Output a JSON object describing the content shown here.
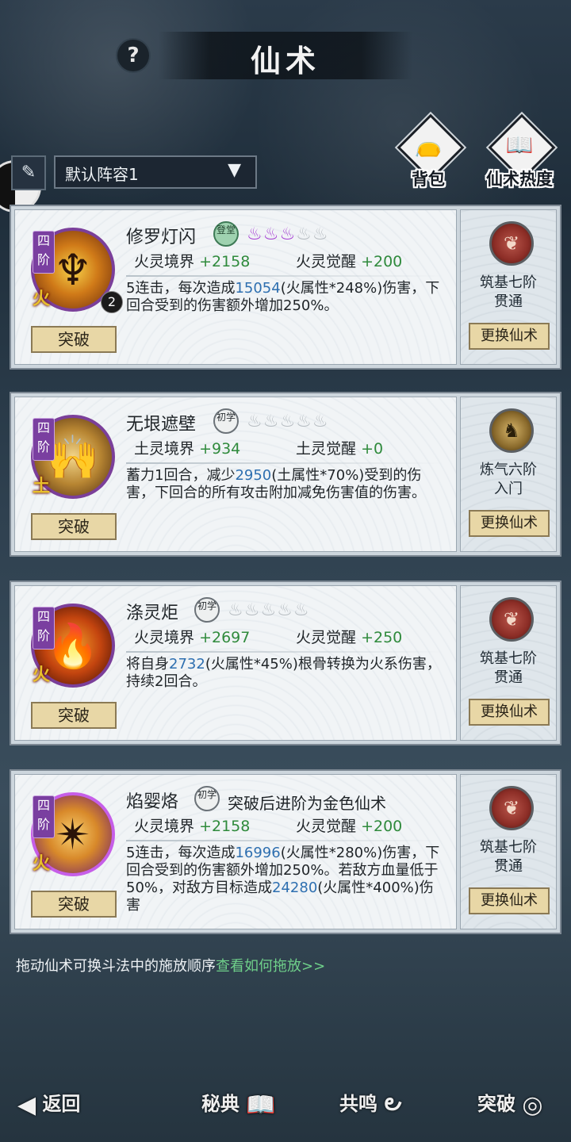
{
  "header": {
    "title": "仙术",
    "help_icon": "?"
  },
  "top_buttons": [
    {
      "label": "背包",
      "icon": "bag-icon",
      "glyph": "👝"
    },
    {
      "label": "仙术热度",
      "icon": "book-flame-icon",
      "glyph": "📖"
    }
  ],
  "lineup": {
    "selected": "默认阵容1",
    "pen_glyph": "✎",
    "chevron": "▼"
  },
  "skills": [
    {
      "tier": "四阶",
      "element": "火",
      "name": "修罗灯闪",
      "rank": "登堂",
      "count": "2",
      "flames_on": "♨♨♨",
      "flames_off": "♨♨",
      "note": "",
      "stat1_label": "火灵境界",
      "stat1_value": "+2158",
      "stat2_label": "火灵觉醒",
      "stat2_value": "+200",
      "desc_pre": "5连击，每次造成",
      "desc_hl": "15054",
      "desc_post": "(火属性*248%)伤害，下回合受到的伤害额外增加250%。",
      "desc_hl2": "",
      "desc_post2": "",
      "break_label": "突破",
      "realm": "筑基七阶",
      "realm_sub": "贯通",
      "swap_label": "更换仙术"
    },
    {
      "tier": "四阶",
      "element": "土",
      "name": "无垠遮壁",
      "rank": "初学",
      "count": "",
      "flames_on": "",
      "flames_off": "♨♨♨♨♨",
      "note": "",
      "stat1_label": "土灵境界",
      "stat1_value": "+934",
      "stat2_label": "土灵觉醒",
      "stat2_value": "+0",
      "desc_pre": "蓄力1回合，减少",
      "desc_hl": "2950",
      "desc_post": "(土属性*70%)受到的伤害，下回合的所有攻击附加减免伤害值的伤害。",
      "desc_hl2": "",
      "desc_post2": "",
      "break_label": "突破",
      "realm": "炼气六阶",
      "realm_sub": "入门",
      "swap_label": "更换仙术"
    },
    {
      "tier": "四阶",
      "element": "火",
      "name": "涤灵炬",
      "rank": "初学",
      "count": "",
      "flames_on": "",
      "flames_off": "♨♨♨♨♨",
      "note": "",
      "stat1_label": "火灵境界",
      "stat1_value": "+2697",
      "stat2_label": "火灵觉醒",
      "stat2_value": "+250",
      "desc_pre": "将自身",
      "desc_hl": "2732",
      "desc_post": "(火属性*45%)根骨转换为火系伤害，持续2回合。",
      "desc_hl2": "",
      "desc_post2": "",
      "break_label": "突破",
      "realm": "筑基七阶",
      "realm_sub": "贯通",
      "swap_label": "更换仙术"
    },
    {
      "tier": "四阶",
      "element": "火",
      "name": "焰婴烙",
      "rank": "初学",
      "count": "",
      "flames_on": "",
      "flames_off": "",
      "note": "突破后进阶为金色仙术",
      "stat1_label": "火灵境界",
      "stat1_value": "+2158",
      "stat2_label": "火灵觉醒",
      "stat2_value": "+200",
      "desc_pre": "5连击，每次造成",
      "desc_hl": "16996",
      "desc_post": "(火属性*280%)伤害，下回合受到的伤害额外增加250%。若敌方血量低于50%，对敌方目标造成",
      "desc_hl2": "24280",
      "desc_post2": "(火属性*400%)伤害",
      "break_label": "突破",
      "realm": "筑基七阶",
      "realm_sub": "贯通",
      "swap_label": "更换仙术"
    }
  ],
  "hint": {
    "text": "拖动仙术可换斗法中的施放顺序",
    "link": "查看如何拖放>>"
  },
  "bottom_nav": [
    {
      "label": "返回",
      "icon": "back-arrow-icon",
      "glyph": "◀"
    },
    {
      "label": "秘典",
      "icon": "open-book-icon",
      "glyph": "📖"
    },
    {
      "label": "共鸣",
      "icon": "cloud-swirl-icon",
      "glyph": "౿"
    },
    {
      "label": "突破",
      "icon": "spiral-icon",
      "glyph": "◎"
    }
  ],
  "colors": {
    "stat_value": "#2f8a3c",
    "desc_highlight": "#2e6fb0",
    "hint_link": "#6fd08a",
    "flame_active": "#a53bd3",
    "tier_badge": "#7a3fa0"
  }
}
